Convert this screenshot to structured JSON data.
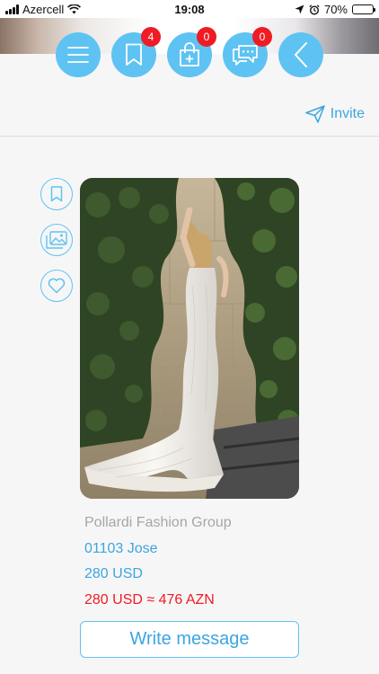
{
  "status_bar": {
    "carrier": "Azercell",
    "time": "19:08",
    "battery_text": "70%",
    "battery_level": 0.7
  },
  "header": {
    "buttons": [
      {
        "name": "menu-button",
        "icon": "menu-icon"
      },
      {
        "name": "bookmarks-button",
        "icon": "bookmark-icon",
        "badge": "4"
      },
      {
        "name": "cart-button",
        "icon": "shopping-bag-plus-icon",
        "badge": "0"
      },
      {
        "name": "messages-button",
        "icon": "chat-bubbles-icon",
        "badge": "0"
      },
      {
        "name": "back-button",
        "icon": "chevron-left-icon"
      }
    ],
    "invite_label": "Invite"
  },
  "side_actions": [
    {
      "name": "bookmark-action",
      "icon": "bookmark-icon"
    },
    {
      "name": "gallery-action",
      "icon": "image-gallery-icon"
    },
    {
      "name": "favorite-action",
      "icon": "heart-icon"
    }
  ],
  "product": {
    "image": "bridal-gown-photo",
    "company": "Pollardi Fashion Group",
    "code": "01103 Jose",
    "price": "280 USD",
    "converted_price": "280 USD ≈ 476 AZN"
  },
  "actions": {
    "write_message": "Write message"
  },
  "colors": {
    "accent": "#5ec3f2",
    "accent_text": "#3ba6df",
    "badge": "#ee1c24",
    "price_alert": "#ee1c24",
    "muted_text": "#a6a6a6"
  }
}
